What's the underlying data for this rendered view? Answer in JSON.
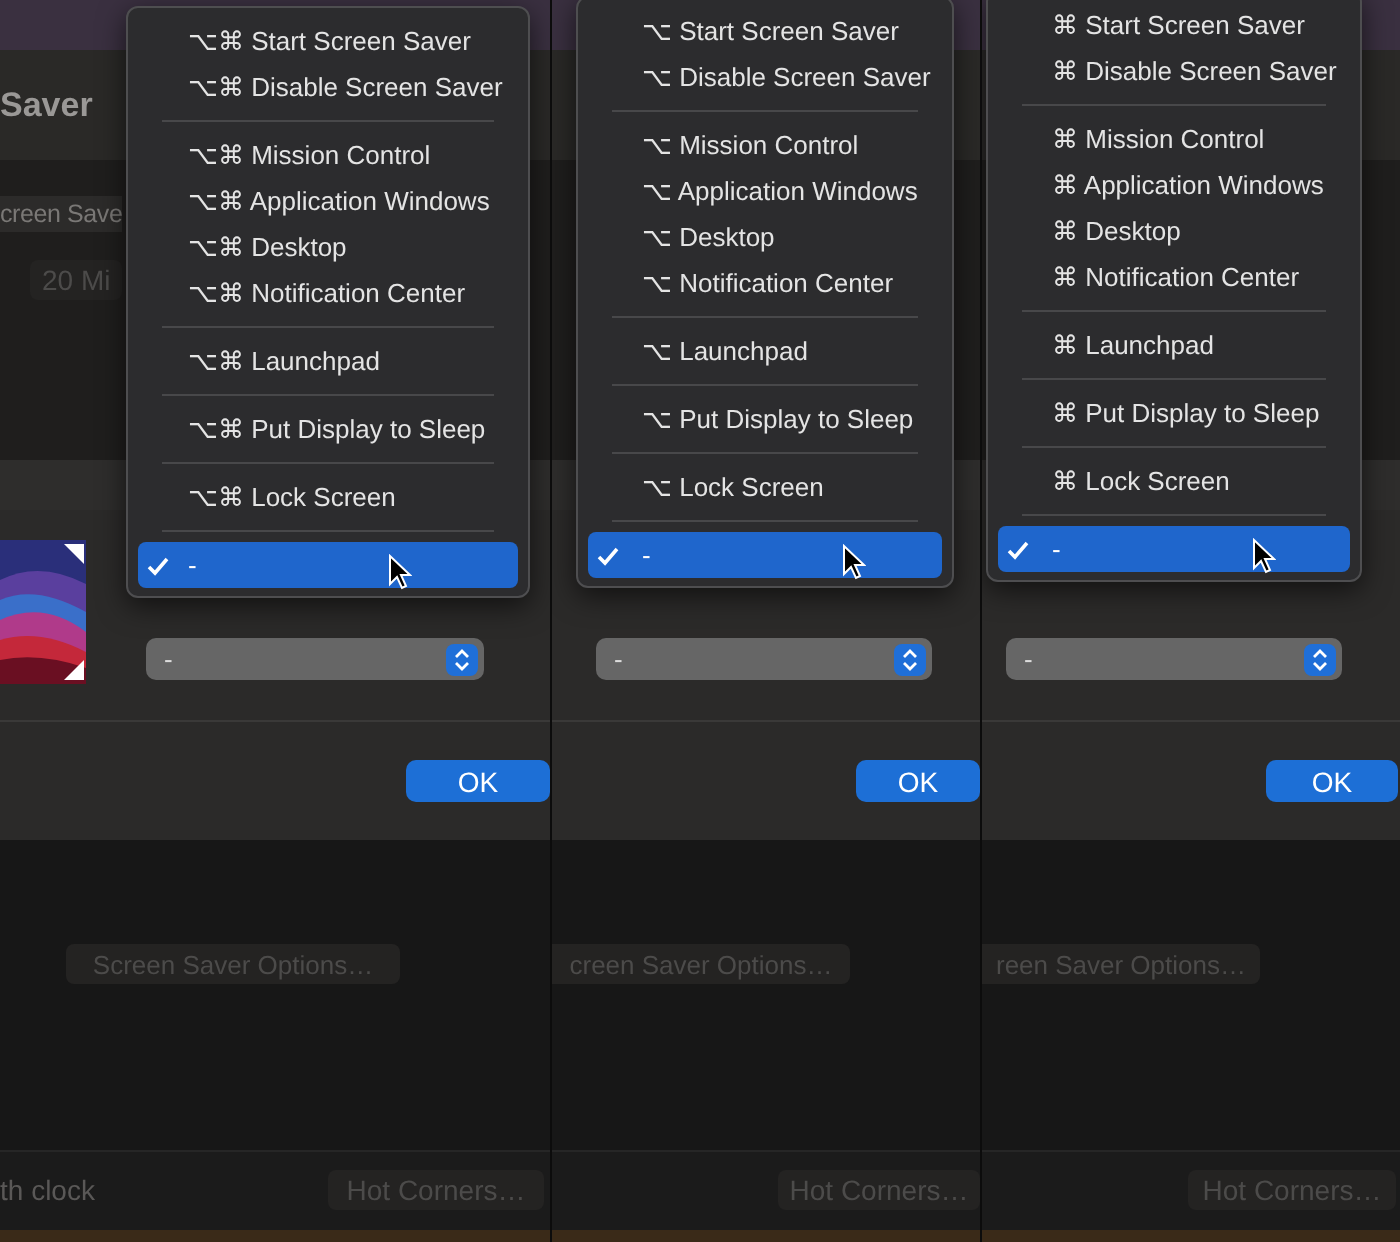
{
  "panels": [
    {
      "title": "Saver",
      "field_label": "creen Save",
      "duration_button": "20 Mi",
      "menu": [
        {
          "kind": "item",
          "label": "⌥⌘ Start Screen Saver",
          "selected": false
        },
        {
          "kind": "item",
          "label": "⌥⌘ Disable Screen Saver",
          "selected": false
        },
        {
          "kind": "separator"
        },
        {
          "kind": "item",
          "label": "⌥⌘ Mission Control",
          "selected": false
        },
        {
          "kind": "item",
          "label": "⌥⌘ Application Windows",
          "selected": false
        },
        {
          "kind": "item",
          "label": "⌥⌘ Desktop",
          "selected": false
        },
        {
          "kind": "item",
          "label": "⌥⌘ Notification Center",
          "selected": false
        },
        {
          "kind": "separator"
        },
        {
          "kind": "item",
          "label": "⌥⌘ Launchpad",
          "selected": false
        },
        {
          "kind": "separator"
        },
        {
          "kind": "item",
          "label": "⌥⌘ Put Display to Sleep",
          "selected": false
        },
        {
          "kind": "separator"
        },
        {
          "kind": "item",
          "label": "⌥⌘ Lock Screen",
          "selected": false
        },
        {
          "kind": "separator"
        },
        {
          "kind": "item",
          "label": "-",
          "selected": true
        }
      ],
      "popup_value": "-",
      "ok_button": "OK",
      "options_button": "Screen Saver Options…",
      "footer_label": "th clock",
      "hot_corners_button": "Hot Corners…"
    },
    {
      "menu": [
        {
          "kind": "item",
          "label": "⌥ Start Screen Saver",
          "selected": false
        },
        {
          "kind": "item",
          "label": "⌥ Disable Screen Saver",
          "selected": false
        },
        {
          "kind": "separator"
        },
        {
          "kind": "item",
          "label": "⌥ Mission Control",
          "selected": false
        },
        {
          "kind": "item",
          "label": "⌥ Application Windows",
          "selected": false
        },
        {
          "kind": "item",
          "label": "⌥ Desktop",
          "selected": false
        },
        {
          "kind": "item",
          "label": "⌥ Notification Center",
          "selected": false
        },
        {
          "kind": "separator"
        },
        {
          "kind": "item",
          "label": "⌥ Launchpad",
          "selected": false
        },
        {
          "kind": "separator"
        },
        {
          "kind": "item",
          "label": "⌥ Put Display to Sleep",
          "selected": false
        },
        {
          "kind": "separator"
        },
        {
          "kind": "item",
          "label": "⌥ Lock Screen",
          "selected": false
        },
        {
          "kind": "separator"
        },
        {
          "kind": "item",
          "label": "-",
          "selected": true
        }
      ],
      "popup_value": "-",
      "ok_button": "OK",
      "options_button": "creen Saver Options…",
      "hot_corners_button": "Hot Corners…"
    },
    {
      "menu": [
        {
          "kind": "item",
          "label": "⌘ Start Screen Saver",
          "selected": false
        },
        {
          "kind": "item",
          "label": "⌘ Disable Screen Saver",
          "selected": false
        },
        {
          "kind": "separator"
        },
        {
          "kind": "item",
          "label": "⌘ Mission Control",
          "selected": false
        },
        {
          "kind": "item",
          "label": "⌘ Application Windows",
          "selected": false
        },
        {
          "kind": "item",
          "label": "⌘ Desktop",
          "selected": false
        },
        {
          "kind": "item",
          "label": "⌘ Notification Center",
          "selected": false
        },
        {
          "kind": "separator"
        },
        {
          "kind": "item",
          "label": "⌘ Launchpad",
          "selected": false
        },
        {
          "kind": "separator"
        },
        {
          "kind": "item",
          "label": "⌘ Put Display to Sleep",
          "selected": false
        },
        {
          "kind": "separator"
        },
        {
          "kind": "item",
          "label": "⌘ Lock Screen",
          "selected": false
        },
        {
          "kind": "separator"
        },
        {
          "kind": "item",
          "label": "-",
          "selected": true
        }
      ],
      "popup_value": "-",
      "ok_button": "OK",
      "options_button": "reen Saver Options…",
      "hot_corners_button": "Hot Corners…"
    }
  ]
}
